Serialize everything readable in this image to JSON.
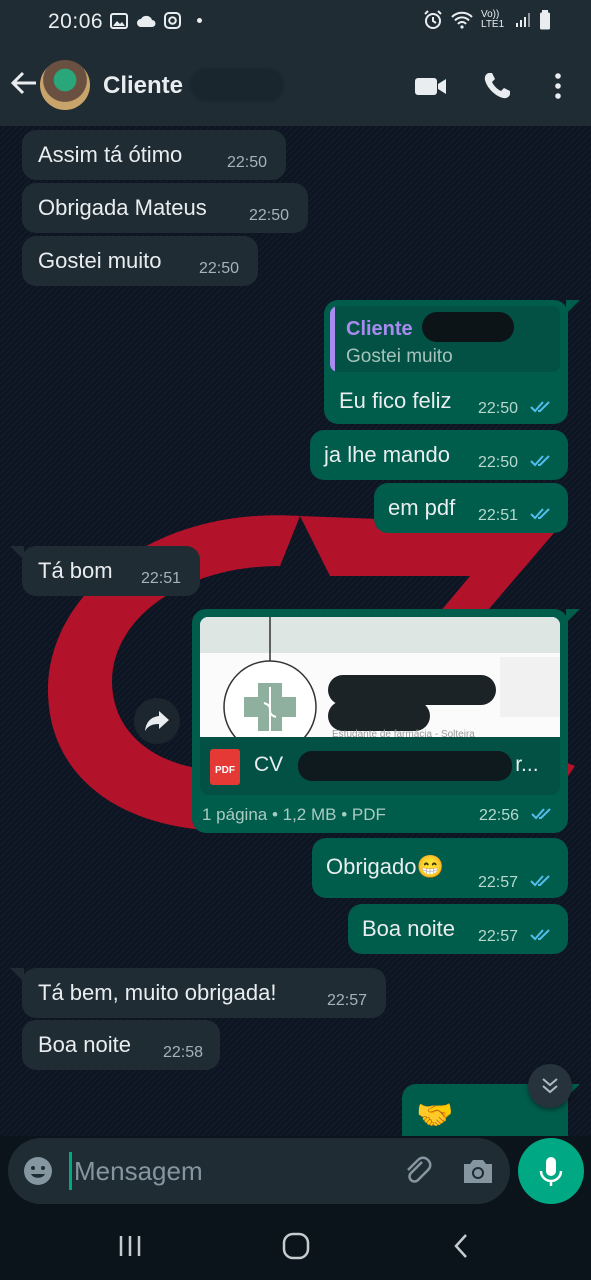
{
  "status_bar": {
    "time": "20:06",
    "network": "Vo)) LTE1"
  },
  "header": {
    "contact_name": "Cliente"
  },
  "messages": [
    {
      "direction": "in",
      "text": "Assim tá ótimo",
      "time": "22:50"
    },
    {
      "direction": "in",
      "text": "Obrigada Mateus",
      "time": "22:50"
    },
    {
      "direction": "in",
      "text": "Gostei muito",
      "time": "22:50"
    },
    {
      "direction": "out",
      "quote_author": "Cliente",
      "quote_text": "Gostei muito",
      "text": "Eu fico feliz",
      "time": "22:50"
    },
    {
      "direction": "out",
      "text": "ja lhe mando",
      "time": "22:50"
    },
    {
      "direction": "out",
      "text": "em pdf",
      "time": "22:51"
    },
    {
      "direction": "in",
      "text": "Tá bom",
      "time": "22:51"
    },
    {
      "direction": "out",
      "type": "document",
      "file_prefix": "CV",
      "file_suffix": "r...",
      "file_type_label": "PDF",
      "meta": "1 página • 1,2 MB • PDF",
      "time": "22:56",
      "preview_caption": "Estudante de farmácia - Solteira"
    },
    {
      "direction": "out",
      "text": "Obrigado😁",
      "time": "22:57"
    },
    {
      "direction": "out",
      "text": "Boa noite",
      "time": "22:57"
    },
    {
      "direction": "in",
      "text": "Tá bem, muito obrigada!",
      "time": "22:57"
    },
    {
      "direction": "in",
      "text": "Boa noite",
      "time": "22:58"
    },
    {
      "direction": "out",
      "text": "🤝",
      "time": ""
    }
  ],
  "composer": {
    "placeholder": "Mensagem"
  },
  "colors": {
    "header_bg": "#1f2c34",
    "incoming_bubble": "#1f2c34",
    "outgoing_bubble": "#005c4b",
    "accent": "#00a884",
    "read_ticks": "#53bdeb",
    "wallpaper_red": "#b3122b"
  },
  "icons": {
    "back": "arrow-left-icon",
    "video": "video-camera-icon",
    "call": "phone-icon",
    "menu": "more-vertical-icon",
    "emoji": "emoji-icon",
    "attach": "paperclip-icon",
    "camera": "camera-icon",
    "mic": "microphone-icon",
    "forward": "forward-icon",
    "scroll_down": "double-chevron-down-icon"
  }
}
